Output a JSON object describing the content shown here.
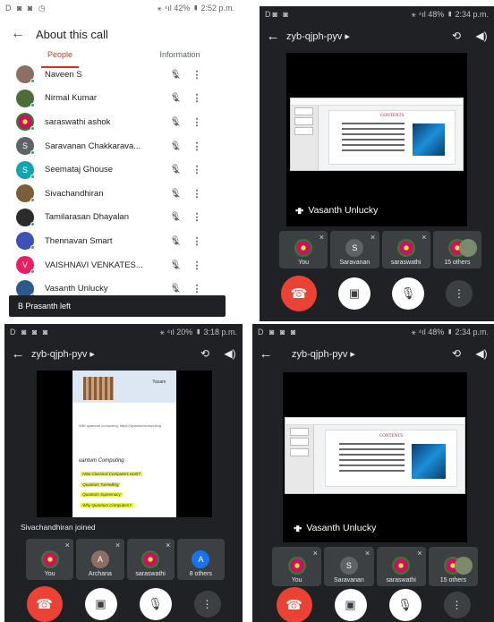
{
  "panel_a": {
    "status_left": "D ◙ ◙ ◷",
    "status_right": "⚹ ⁴ıl 42% ▮ 2:52 p.m.",
    "title": "About this call",
    "tabs": [
      "People",
      "Information"
    ],
    "participants": [
      {
        "name": "Naveen S",
        "avatar": "photo",
        "color": "#8d6e63"
      },
      {
        "name": "Nirmal Kumar",
        "avatar": "photo",
        "color": "#4e6b3a"
      },
      {
        "name": "saraswathi ashok",
        "avatar": "flower",
        "color": "#c2185b"
      },
      {
        "name": "Saravanan Chakkarava...",
        "avatar": "S",
        "color": "#5f6368"
      },
      {
        "name": "Seemataj Ghouse",
        "avatar": "S",
        "color": "#12a4af"
      },
      {
        "name": "Sivachandhiran",
        "avatar": "photo",
        "color": "#7b5e3a"
      },
      {
        "name": "Tamilarasan Dhayalan",
        "avatar": "photo",
        "color": "#2b2b2b"
      },
      {
        "name": "Thennavan Smart",
        "avatar": "photo",
        "color": "#3f51b5"
      },
      {
        "name": "VAISHNAVI VENKATES...",
        "avatar": "V",
        "color": "#e91e63"
      },
      {
        "name": "Vasanth Unlucky",
        "avatar": "photo",
        "color": "#2d5a8a"
      }
    ],
    "toast": "B Prasanth left"
  },
  "panel_b": {
    "status_left": "D◙ ◙",
    "status_right": "⚹ ⁴ıl 48% ▮ 2:34 p.m.",
    "meeting_code": "zyb-qjph-pyv",
    "slide_heading": "CONTENTS",
    "speaker": "Vasanth Unlucky",
    "tiles": [
      {
        "label": "You",
        "avatar": "flower"
      },
      {
        "label": "Saravanan",
        "avatar": "S"
      },
      {
        "label": "saraswathi",
        "avatar": "flower"
      },
      {
        "label": "15 others",
        "avatar": "duo"
      }
    ]
  },
  "panel_c": {
    "status_left": "D ◙ ◙ ◙",
    "status_right": "⚹ ⁴ıl 20% ▮ 3:18 p.m.",
    "meeting_code": "zyb-qjph-pyv",
    "doc_title": "Yasam",
    "doc_link": "Wiki quantum computing:  https://quantumcomputing.",
    "doc_subtitle": "uantum Computing",
    "doc_highlights": [
      "How Classical Computers work?",
      "Quantum Tunnelling",
      "Quantum Supremacy",
      "Why Quantum Computers?"
    ],
    "joined": "Sivachandhiran joined",
    "tiles": [
      {
        "label": "You",
        "avatar": "flower"
      },
      {
        "label": "Archana",
        "avatar": "A"
      },
      {
        "label": "saraswathi",
        "avatar": "flower"
      },
      {
        "label": "8 others",
        "avatar": "A"
      }
    ]
  },
  "panel_d": {
    "status_left": "D ◙ ◙ ◙",
    "status_right": "⚹ ⁴ıl 48% ▮ 2:34 p.m.",
    "meeting_code": "zyb-qjph-pyv",
    "slide_heading": "CONTENTS",
    "speaker": "Vasanth Unlucky",
    "tiles": [
      {
        "label": "You",
        "avatar": "flower"
      },
      {
        "label": "Saravanan",
        "avatar": "S"
      },
      {
        "label": "saraswathi",
        "avatar": "flower"
      },
      {
        "label": "15 others",
        "avatar": "duo"
      }
    ]
  },
  "icons": {
    "back": "←",
    "dropdown": "▸",
    "switch_camera": "⟲",
    "speaker": "◀)",
    "more": "⋮",
    "end_call": "☎",
    "camera_off": "▣",
    "mic_off": "🎙",
    "muted_small": "⨯"
  }
}
